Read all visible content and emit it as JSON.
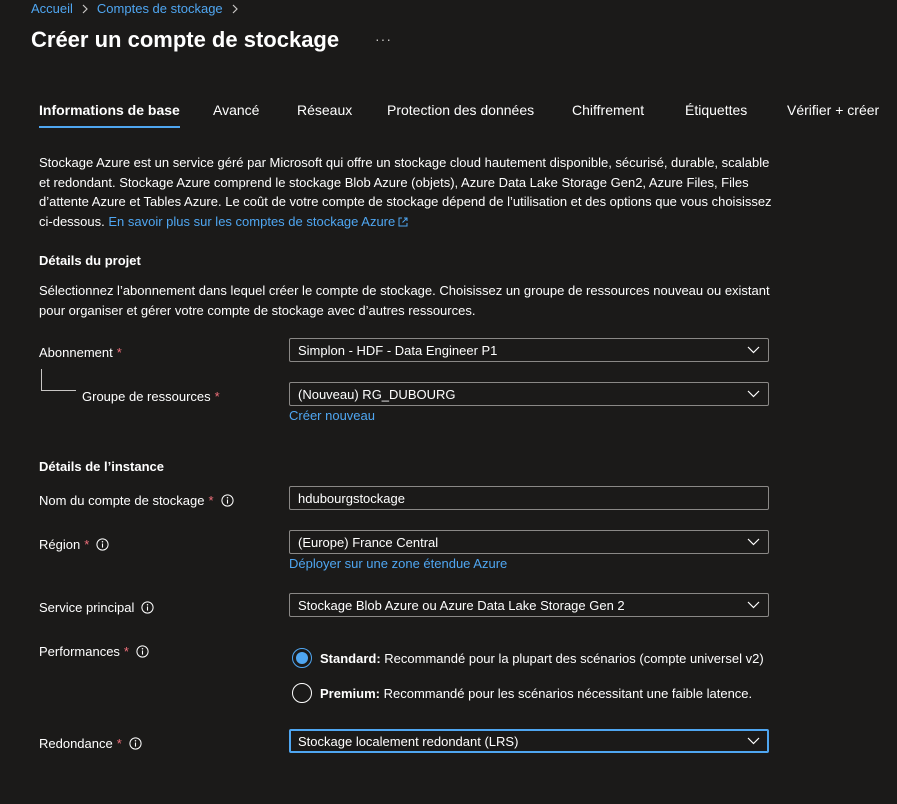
{
  "breadcrumb": {
    "home": "Accueil",
    "current": "Comptes de stockage"
  },
  "page": {
    "title": "Créer un compte de stockage",
    "more": "···"
  },
  "tabs": [
    {
      "label": "Informations de base"
    },
    {
      "label": "Avancé"
    },
    {
      "label": "Réseaux"
    },
    {
      "label": "Protection des données"
    },
    {
      "label": "Chiffrement"
    },
    {
      "label": "Étiquettes"
    },
    {
      "label": "Vérifier + créer"
    }
  ],
  "intro": {
    "text": "Stockage Azure est un service géré par Microsoft qui offre un stockage cloud hautement disponible, sécurisé, durable, scalable et redondant. Stockage Azure comprend le stockage Blob Azure (objets), Azure Data Lake Storage Gen2, Azure Files, Files d’attente Azure et Tables Azure. Le coût de votre compte de stockage dépend de l’utilisation et des options que vous choisissez ci-dessous.",
    "link": "En savoir plus sur les comptes de stockage Azure"
  },
  "project": {
    "title": "Détails du projet",
    "description": "Sélectionnez l’abonnement dans lequel créer le compte de stockage. Choisissez un groupe de ressources nouveau ou existant pour organiser et gérer votre compte de stockage avec d’autres ressources.",
    "subscription_label": "Abonnement",
    "subscription_value": "Simplon - HDF - Data Engineer P1",
    "rg_label": "Groupe de ressources",
    "rg_value": "(Nouveau) RG_DUBOURG",
    "rg_create_new": "Créer nouveau"
  },
  "instance": {
    "title": "Détails de l’instance",
    "name_label": "Nom du compte de stockage",
    "name_value": "hdubourgstockage",
    "region_label": "Région",
    "region_value": "(Europe) France Central",
    "region_link": "Déployer sur une zone étendue Azure",
    "service_label": "Service principal",
    "service_value": "Stockage Blob Azure ou Azure Data Lake Storage Gen 2",
    "performance_label": "Performances",
    "perf_standard_title": "Standard:",
    "perf_standard_desc": "Recommandé pour la plupart des scénarios (compte universel v2)",
    "perf_premium_title": "Premium:",
    "perf_premium_desc": "Recommandé pour les scénarios nécessitant une faible latence.",
    "redundancy_label": "Redondance",
    "redundancy_value": "Stockage localement redondant (LRS)"
  },
  "required_mark": "*",
  "colors": {
    "accent": "#4fa6f1",
    "background": "#1b1a19",
    "required": "#f1707b"
  }
}
